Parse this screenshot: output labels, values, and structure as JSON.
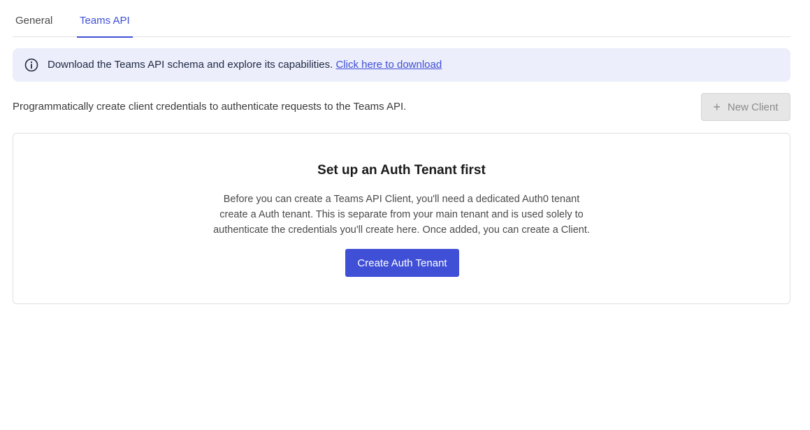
{
  "tabs": [
    {
      "label": "General",
      "active": false
    },
    {
      "label": "Teams API",
      "active": true
    }
  ],
  "banner": {
    "icon": "info-icon",
    "text": "Download the Teams API schema and explore its capabilities.",
    "link_label": "Click here to download"
  },
  "description": "Programmatically create client credentials to authenticate requests to the Teams API.",
  "new_client_button": {
    "label": "New Client",
    "icon": "plus-icon",
    "disabled": true
  },
  "card": {
    "title": "Set up an Auth Tenant first",
    "body_lines": [
      "Before you can create a Teams API Client, you'll need a dedicated Auth0 tenant",
      "create a Auth tenant. This is separate from your main tenant and is used solely to",
      "authenticate the credentials you'll create here. Once added, you can create a Client."
    ],
    "button_label": "Create Auth Tenant"
  },
  "colors": {
    "accent": "#3f4fd6",
    "banner_bg": "#eceefb",
    "disabled_bg": "#e6e6e6"
  }
}
